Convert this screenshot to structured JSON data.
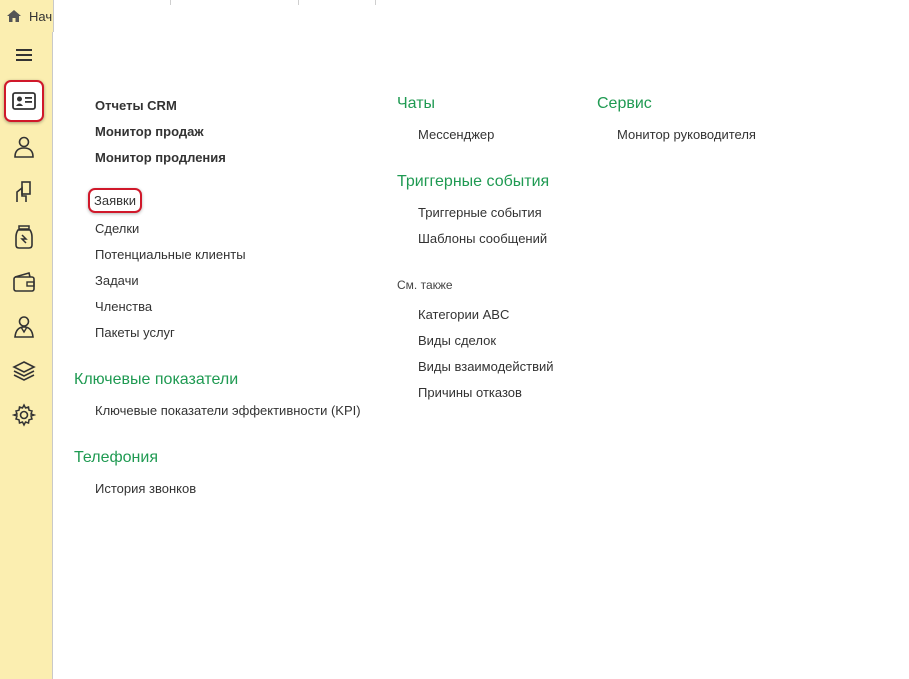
{
  "topbar": {
    "home_label": "Нач"
  },
  "sidebar": {
    "items": [
      {
        "name": "menu-icon"
      },
      {
        "name": "crm-icon"
      },
      {
        "name": "person-icon"
      },
      {
        "name": "hand-card-icon"
      },
      {
        "name": "jar-icon"
      },
      {
        "name": "wallet-icon"
      },
      {
        "name": "person-alt-icon"
      },
      {
        "name": "stack-icon"
      },
      {
        "name": "gear-icon"
      }
    ]
  },
  "col1": {
    "reports": [
      "Отчеты CRM",
      "Монитор продаж",
      "Монитор продления"
    ],
    "links": [
      "Заявки",
      "Сделки",
      "Потенциальные клиенты",
      "Задачи",
      "Членства",
      "Пакеты услуг"
    ],
    "kpi_header": "Ключевые показатели",
    "kpi_link": "Ключевые показатели эффективности (KPI)",
    "tel_header": "Телефония",
    "tel_link": "История звонков"
  },
  "col2": {
    "chats_header": "Чаты",
    "chats_link": "Мессенджер",
    "trig_header": "Триггерные события",
    "trig_links": [
      "Триггерные события",
      "Шаблоны сообщений"
    ],
    "see_also": "См. также",
    "see_links": [
      "Категории ABC",
      "Виды сделок",
      "Виды взаимодействий",
      "Причины отказов"
    ]
  },
  "col3": {
    "service_header": "Сервис",
    "service_link": "Монитор руководителя"
  },
  "colors": {
    "accent": "#1f9a52",
    "highlight": "#d0182a",
    "sidebar": "#fbeeb0"
  }
}
